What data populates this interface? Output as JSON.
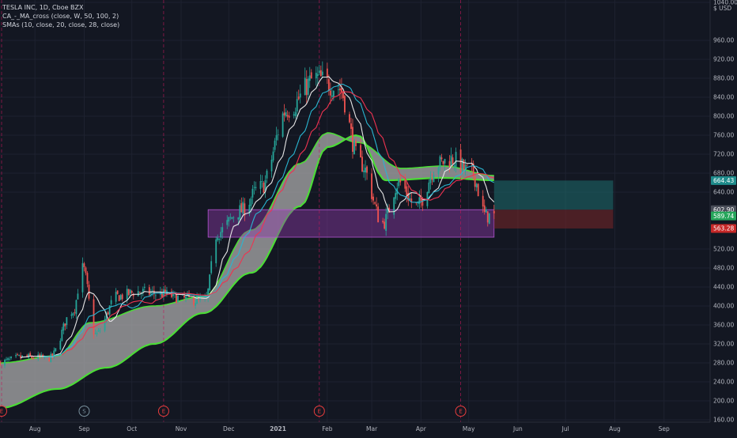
{
  "header": {
    "line1": "TESLA INC, 1D, Cboe BZX",
    "line2": "CA_-_MA_cross (close, W, 50, 100, 2)",
    "line3": "SMAs (10, close, 20, close, 28, close)"
  },
  "currency": "USD",
  "colors": {
    "background": "#131722",
    "grid": "#1e2230",
    "up": "#26a69a",
    "down": "#ef5350",
    "sma10": "#e6e6e6",
    "sma20": "#29b6d1",
    "sma28": "#ef3350",
    "ma_band_edge": "#4cdc37",
    "ma_band_fill": "#b0b0b0",
    "zone_purple": "#8e3aa8",
    "target_teal": "#1e6e6e",
    "stop_red": "#7a2628",
    "event_red": "#e83d3d",
    "event_teal": "#78909c"
  },
  "chart_data": {
    "type": "candlestick",
    "y_axis": {
      "min": 155,
      "max": 1045,
      "ticks": [
        "160.00",
        "200.00",
        "240.00",
        "280.00",
        "320.00",
        "360.00",
        "400.00",
        "440.00",
        "480.00",
        "520.00",
        "640.00",
        "680.00",
        "720.00",
        "760.00",
        "800.00",
        "840.00",
        "880.00",
        "920.00",
        "960.00",
        "1040.00"
      ],
      "tick_values": [
        160,
        200,
        240,
        280,
        320,
        360,
        400,
        440,
        480,
        520,
        640,
        680,
        720,
        760,
        800,
        840,
        880,
        920,
        960,
        1040
      ],
      "scale": "linear"
    },
    "x_axis": {
      "labels": [
        "Aug",
        "Sep",
        "Oct",
        "Nov",
        "Dec",
        "2021",
        "Feb",
        "Mar",
        "Apr",
        "May",
        "Jun",
        "Jul",
        "Aug",
        "Sep"
      ],
      "label_dates": [
        "2020-08-01",
        "2020-09-01",
        "2020-10-01",
        "2020-11-01",
        "2020-12-01",
        "2021-01-01",
        "2021-02-01",
        "2021-03-01",
        "2021-04-01",
        "2021-05-01",
        "2021-06-01",
        "2021-07-01",
        "2021-08-01",
        "2021-09-01"
      ],
      "start_date": "2020-07-10",
      "end_date": "2021-09-30"
    },
    "price_tags": [
      {
        "value": 664.43,
        "label": "664.43",
        "color": "#1e8b8b"
      },
      {
        "value": 602.9,
        "label": "602.90",
        "color": "#4a4e59"
      },
      {
        "value": 589.74,
        "label": "589.74",
        "color": "#26a65b"
      },
      {
        "value": 563.28,
        "label": "563.28",
        "color": "#c62828"
      }
    ],
    "monthly_close_anchors": [
      {
        "date": "2020-07-10",
        "close": 282
      },
      {
        "date": "2020-07-25",
        "close": 292
      },
      {
        "date": "2020-08-10",
        "close": 290
      },
      {
        "date": "2020-08-25",
        "close": 390
      },
      {
        "date": "2020-08-31",
        "close": 480
      },
      {
        "date": "2020-09-08",
        "close": 340
      },
      {
        "date": "2020-09-22",
        "close": 420
      },
      {
        "date": "2020-10-05",
        "close": 430
      },
      {
        "date": "2020-10-20",
        "close": 425
      },
      {
        "date": "2020-11-03",
        "close": 415
      },
      {
        "date": "2020-11-16",
        "close": 410
      },
      {
        "date": "2020-11-24",
        "close": 555
      },
      {
        "date": "2020-12-08",
        "close": 600
      },
      {
        "date": "2020-12-21",
        "close": 650
      },
      {
        "date": "2021-01-07",
        "close": 815
      },
      {
        "date": "2021-01-25",
        "close": 880
      },
      {
        "date": "2021-02-08",
        "close": 860
      },
      {
        "date": "2021-02-22",
        "close": 700
      },
      {
        "date": "2021-03-08",
        "close": 575
      },
      {
        "date": "2021-03-18",
        "close": 660
      },
      {
        "date": "2021-03-29",
        "close": 610
      },
      {
        "date": "2021-04-12",
        "close": 700
      },
      {
        "date": "2021-04-20",
        "close": 710
      },
      {
        "date": "2021-05-03",
        "close": 680
      },
      {
        "date": "2021-05-12",
        "close": 590
      },
      {
        "date": "2021-05-17",
        "close": 589
      }
    ],
    "ma_band": {
      "fast_anchors": [
        {
          "date": "2020-07-10",
          "value": 280
        },
        {
          "date": "2020-08-15",
          "value": 295
        },
        {
          "date": "2020-09-05",
          "value": 365
        },
        {
          "date": "2020-10-15",
          "value": 400
        },
        {
          "date": "2020-11-15",
          "value": 420
        },
        {
          "date": "2020-12-15",
          "value": 560
        },
        {
          "date": "2021-01-15",
          "value": 700
        },
        {
          "date": "2021-02-01",
          "value": 765
        },
        {
          "date": "2021-02-20",
          "value": 745
        },
        {
          "date": "2021-03-20",
          "value": 690
        },
        {
          "date": "2021-04-15",
          "value": 695
        },
        {
          "date": "2021-05-17",
          "value": 675
        }
      ],
      "slow_anchors": [
        {
          "date": "2020-07-10",
          "value": 185
        },
        {
          "date": "2020-08-15",
          "value": 225
        },
        {
          "date": "2020-09-15",
          "value": 270
        },
        {
          "date": "2020-10-15",
          "value": 320
        },
        {
          "date": "2020-11-15",
          "value": 385
        },
        {
          "date": "2020-12-15",
          "value": 470
        },
        {
          "date": "2021-01-15",
          "value": 610
        },
        {
          "date": "2021-02-01",
          "value": 735
        },
        {
          "date": "2021-02-20",
          "value": 760
        },
        {
          "date": "2021-03-10",
          "value": 665
        },
        {
          "date": "2021-04-15",
          "value": 670
        },
        {
          "date": "2021-05-17",
          "value": 665
        }
      ]
    },
    "sma_series": [
      {
        "period": 10,
        "color": "#e6e6e6"
      },
      {
        "period": 20,
        "color": "#29b6d1"
      },
      {
        "period": 28,
        "color": "#ef3350"
      }
    ],
    "zones": [
      {
        "kind": "range",
        "start": "2020-11-18",
        "end": "2021-05-17",
        "low": 545,
        "high": 603,
        "color": "#8e3aa8"
      },
      {
        "kind": "target",
        "start": "2021-05-17",
        "end": "2021-07-31",
        "low": 603,
        "high": 664.43,
        "color": "#1e6e6e"
      },
      {
        "kind": "stop",
        "start": "2021-05-17",
        "end": "2021-07-31",
        "low": 563.28,
        "high": 603,
        "color": "#7a2628"
      }
    ],
    "vertical_markers": [
      "2020-07-11",
      "2020-10-21",
      "2021-01-27",
      "2021-04-26"
    ],
    "events": [
      {
        "date": "2020-07-11",
        "label": "E",
        "kind": "earnings"
      },
      {
        "date": "2020-09-01",
        "label": "S",
        "kind": "split"
      },
      {
        "date": "2020-10-21",
        "label": "E",
        "kind": "earnings"
      },
      {
        "date": "2021-01-27",
        "label": "E",
        "kind": "earnings"
      },
      {
        "date": "2021-04-26",
        "label": "E",
        "kind": "earnings"
      }
    ]
  }
}
